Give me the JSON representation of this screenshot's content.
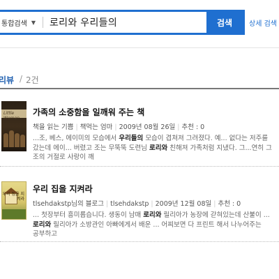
{
  "search": {
    "scope_label": "통합검색",
    "scope_chevron": "▼",
    "query": "로리와 우리들의",
    "button_label": "검색",
    "detail_link": "상세 검색"
  },
  "section": {
    "title": "리뷰",
    "separator": "/",
    "count": "2건"
  },
  "reviews": [
    {
      "title": "가족의 소중함을 일깨워 주는 책",
      "author": "책을 읽는 기쁨",
      "blog": "책먹는 엄마",
      "date": "2009년 08월 26일",
      "recommend": "추천 : 0",
      "snippet": [
        {
          "pre": "...조, 베스, 에이미의 모습에서 ",
          "hl": "우리들의",
          "post": " 모습이 겹쳐져 그려졌다. 예... 없다는 저주를"
        },
        {
          "pre": "갔는데 에이... 버렸고 조는 무뚝뚝 도련님 ",
          "hl": "로리와",
          "post": " 친해져 가족처럼 지냈다. 그...연히 그"
        },
        {
          "pre": "조의 거절로 사랑이 깨",
          "hl": "",
          "post": ""
        }
      ],
      "cover_caption": "Little Women"
    },
    {
      "title": "우리 집을 지켜라",
      "author": "tlsehdakstp님의 블로그",
      "blog": "tlsehdakstp",
      "date": "2009년 12월 08일",
      "recommend": "추천 : 0",
      "snippet": [
        {
          "pre": "... 첫장부터 흥미롭습니다. 생동이 남매 ",
          "hl": "로리와",
          "post": " 릴리아가 농장에 갇혀있는데 산불이 ..."
        },
        {
          "pre": "",
          "hl": "로리와",
          "post": " 릴리아가 소방관인 아빠에게서 배운 ... 어찌보면 다 프린트 해서 나누어주는"
        },
        {
          "pre": "공부하고",
          "hl": "",
          "post": ""
        }
      ],
      "cover_caption": "우리 집을 지켜라"
    }
  ],
  "colors": {
    "accent": "#1f6fd0",
    "section_title": "#2060b0"
  }
}
